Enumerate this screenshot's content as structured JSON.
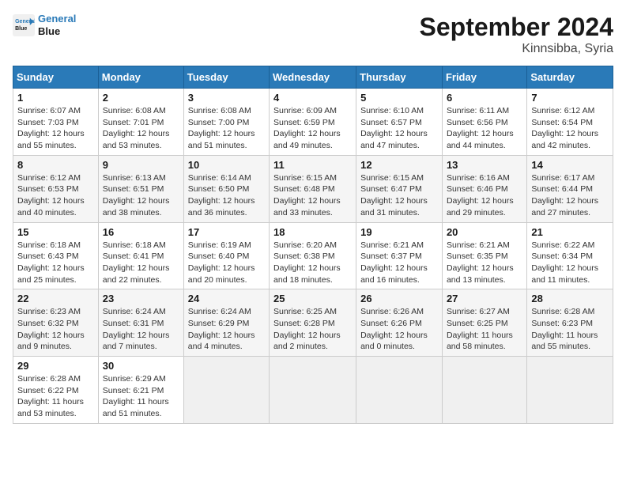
{
  "header": {
    "logo_line1": "General",
    "logo_line2": "Blue",
    "month": "September 2024",
    "location": "Kinnsibba, Syria"
  },
  "weekdays": [
    "Sunday",
    "Monday",
    "Tuesday",
    "Wednesday",
    "Thursday",
    "Friday",
    "Saturday"
  ],
  "weeks": [
    [
      {
        "day": "1",
        "detail": "Sunrise: 6:07 AM\nSunset: 7:03 PM\nDaylight: 12 hours\nand 55 minutes."
      },
      {
        "day": "2",
        "detail": "Sunrise: 6:08 AM\nSunset: 7:01 PM\nDaylight: 12 hours\nand 53 minutes."
      },
      {
        "day": "3",
        "detail": "Sunrise: 6:08 AM\nSunset: 7:00 PM\nDaylight: 12 hours\nand 51 minutes."
      },
      {
        "day": "4",
        "detail": "Sunrise: 6:09 AM\nSunset: 6:59 PM\nDaylight: 12 hours\nand 49 minutes."
      },
      {
        "day": "5",
        "detail": "Sunrise: 6:10 AM\nSunset: 6:57 PM\nDaylight: 12 hours\nand 47 minutes."
      },
      {
        "day": "6",
        "detail": "Sunrise: 6:11 AM\nSunset: 6:56 PM\nDaylight: 12 hours\nand 44 minutes."
      },
      {
        "day": "7",
        "detail": "Sunrise: 6:12 AM\nSunset: 6:54 PM\nDaylight: 12 hours\nand 42 minutes."
      }
    ],
    [
      {
        "day": "8",
        "detail": "Sunrise: 6:12 AM\nSunset: 6:53 PM\nDaylight: 12 hours\nand 40 minutes."
      },
      {
        "day": "9",
        "detail": "Sunrise: 6:13 AM\nSunset: 6:51 PM\nDaylight: 12 hours\nand 38 minutes."
      },
      {
        "day": "10",
        "detail": "Sunrise: 6:14 AM\nSunset: 6:50 PM\nDaylight: 12 hours\nand 36 minutes."
      },
      {
        "day": "11",
        "detail": "Sunrise: 6:15 AM\nSunset: 6:48 PM\nDaylight: 12 hours\nand 33 minutes."
      },
      {
        "day": "12",
        "detail": "Sunrise: 6:15 AM\nSunset: 6:47 PM\nDaylight: 12 hours\nand 31 minutes."
      },
      {
        "day": "13",
        "detail": "Sunrise: 6:16 AM\nSunset: 6:46 PM\nDaylight: 12 hours\nand 29 minutes."
      },
      {
        "day": "14",
        "detail": "Sunrise: 6:17 AM\nSunset: 6:44 PM\nDaylight: 12 hours\nand 27 minutes."
      }
    ],
    [
      {
        "day": "15",
        "detail": "Sunrise: 6:18 AM\nSunset: 6:43 PM\nDaylight: 12 hours\nand 25 minutes."
      },
      {
        "day": "16",
        "detail": "Sunrise: 6:18 AM\nSunset: 6:41 PM\nDaylight: 12 hours\nand 22 minutes."
      },
      {
        "day": "17",
        "detail": "Sunrise: 6:19 AM\nSunset: 6:40 PM\nDaylight: 12 hours\nand 20 minutes."
      },
      {
        "day": "18",
        "detail": "Sunrise: 6:20 AM\nSunset: 6:38 PM\nDaylight: 12 hours\nand 18 minutes."
      },
      {
        "day": "19",
        "detail": "Sunrise: 6:21 AM\nSunset: 6:37 PM\nDaylight: 12 hours\nand 16 minutes."
      },
      {
        "day": "20",
        "detail": "Sunrise: 6:21 AM\nSunset: 6:35 PM\nDaylight: 12 hours\nand 13 minutes."
      },
      {
        "day": "21",
        "detail": "Sunrise: 6:22 AM\nSunset: 6:34 PM\nDaylight: 12 hours\nand 11 minutes."
      }
    ],
    [
      {
        "day": "22",
        "detail": "Sunrise: 6:23 AM\nSunset: 6:32 PM\nDaylight: 12 hours\nand 9 minutes."
      },
      {
        "day": "23",
        "detail": "Sunrise: 6:24 AM\nSunset: 6:31 PM\nDaylight: 12 hours\nand 7 minutes."
      },
      {
        "day": "24",
        "detail": "Sunrise: 6:24 AM\nSunset: 6:29 PM\nDaylight: 12 hours\nand 4 minutes."
      },
      {
        "day": "25",
        "detail": "Sunrise: 6:25 AM\nSunset: 6:28 PM\nDaylight: 12 hours\nand 2 minutes."
      },
      {
        "day": "26",
        "detail": "Sunrise: 6:26 AM\nSunset: 6:26 PM\nDaylight: 12 hours\nand 0 minutes."
      },
      {
        "day": "27",
        "detail": "Sunrise: 6:27 AM\nSunset: 6:25 PM\nDaylight: 11 hours\nand 58 minutes."
      },
      {
        "day": "28",
        "detail": "Sunrise: 6:28 AM\nSunset: 6:23 PM\nDaylight: 11 hours\nand 55 minutes."
      }
    ],
    [
      {
        "day": "29",
        "detail": "Sunrise: 6:28 AM\nSunset: 6:22 PM\nDaylight: 11 hours\nand 53 minutes."
      },
      {
        "day": "30",
        "detail": "Sunrise: 6:29 AM\nSunset: 6:21 PM\nDaylight: 11 hours\nand 51 minutes."
      },
      null,
      null,
      null,
      null,
      null
    ]
  ]
}
